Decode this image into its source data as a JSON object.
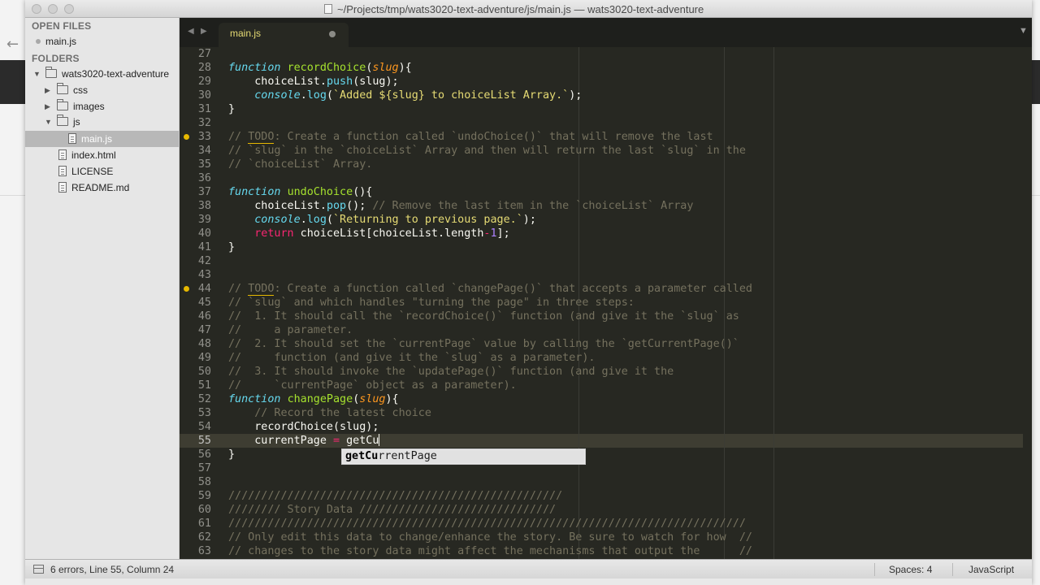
{
  "window": {
    "title": "~/Projects/tmp/wats3020-text-adventure/js/main.js — wats3020-text-adventure"
  },
  "sidebar": {
    "open_files_header": "OPEN FILES",
    "open_files": [
      {
        "label": "main.js"
      }
    ],
    "folders_header": "FOLDERS",
    "tree": [
      {
        "label": "wats3020-text-adventure",
        "type": "folder",
        "expanded": true,
        "depth": 0
      },
      {
        "label": "css",
        "type": "folder",
        "expanded": false,
        "depth": 1
      },
      {
        "label": "images",
        "type": "folder",
        "expanded": false,
        "depth": 1
      },
      {
        "label": "js",
        "type": "folder",
        "expanded": true,
        "depth": 1
      },
      {
        "label": "main.js",
        "type": "file",
        "selected": true,
        "depth": 2
      },
      {
        "label": "index.html",
        "type": "file",
        "depth": 1
      },
      {
        "label": "LICENSE",
        "type": "file",
        "depth": 1
      },
      {
        "label": "README.md",
        "type": "file",
        "depth": 1
      }
    ]
  },
  "tabs": [
    {
      "label": "main.js",
      "modified": true,
      "active": true
    }
  ],
  "editor": {
    "current_line": 55,
    "bookmarked_lines": [
      33,
      44
    ],
    "line_numbers": [
      "27",
      "28",
      "29",
      "30",
      "31",
      "32",
      "33",
      "34",
      "35",
      "36",
      "37",
      "38",
      "39",
      "40",
      "41",
      "42",
      "43",
      "44",
      "45",
      "46",
      "47",
      "48",
      "49",
      "50",
      "51",
      "52",
      "53",
      "54",
      "55",
      "56",
      "57",
      "58",
      "59",
      "60",
      "61",
      "62",
      "63"
    ],
    "code": [
      {
        "l": 27,
        "t": []
      },
      {
        "l": 28,
        "t": [
          [
            "kw",
            "function"
          ],
          [
            "",
            " "
          ],
          [
            "fn",
            "recordChoice"
          ],
          [
            "",
            "("
          ],
          [
            "param",
            "slug"
          ],
          [
            "",
            "){"
          ]
        ]
      },
      {
        "l": 29,
        "t": [
          [
            "",
            "    choiceList."
          ],
          [
            "meth",
            "push"
          ],
          [
            "",
            "(slug);"
          ]
        ]
      },
      {
        "l": 30,
        "t": [
          [
            "",
            "    "
          ],
          [
            "obj",
            "console"
          ],
          [
            "",
            "."
          ],
          [
            "meth",
            "log"
          ],
          [
            "",
            "("
          ],
          [
            "str",
            "`Added ${slug} to choiceList Array.`"
          ],
          [
            "",
            ");"
          ]
        ]
      },
      {
        "l": 31,
        "t": [
          [
            "",
            "}"
          ]
        ]
      },
      {
        "l": 32,
        "t": []
      },
      {
        "l": 33,
        "t": [
          [
            "cmt",
            "// "
          ],
          [
            "cmt todo-u",
            "TODO"
          ],
          [
            "cmt",
            ": Create a function called `undoChoice()` that will remove the last"
          ]
        ]
      },
      {
        "l": 34,
        "t": [
          [
            "cmt",
            "// `slug` in the `choiceList` Array and then will return the last `slug` in the"
          ]
        ]
      },
      {
        "l": 35,
        "t": [
          [
            "cmt",
            "// `choiceList` Array."
          ]
        ]
      },
      {
        "l": 36,
        "t": []
      },
      {
        "l": 37,
        "t": [
          [
            "kw",
            "function"
          ],
          [
            "",
            " "
          ],
          [
            "fn",
            "undoChoice"
          ],
          [
            "",
            "(){"
          ]
        ]
      },
      {
        "l": 38,
        "t": [
          [
            "",
            "    choiceList."
          ],
          [
            "meth",
            "pop"
          ],
          [
            "",
            "(); "
          ],
          [
            "cmt",
            "// Remove the last item in the `choiceList` Array"
          ]
        ]
      },
      {
        "l": 39,
        "t": [
          [
            "",
            "    "
          ],
          [
            "obj",
            "console"
          ],
          [
            "",
            "."
          ],
          [
            "meth",
            "log"
          ],
          [
            "",
            "("
          ],
          [
            "str",
            "`Returning to previous page.`"
          ],
          [
            "",
            ");"
          ]
        ]
      },
      {
        "l": 40,
        "t": [
          [
            "",
            "    "
          ],
          [
            "ret",
            "return"
          ],
          [
            "",
            " choiceList[choiceList.length"
          ],
          [
            "ret",
            "-"
          ],
          [
            "num",
            "1"
          ],
          [
            "",
            "];"
          ]
        ]
      },
      {
        "l": 41,
        "t": [
          [
            "",
            "}"
          ]
        ]
      },
      {
        "l": 42,
        "t": []
      },
      {
        "l": 43,
        "t": []
      },
      {
        "l": 44,
        "t": [
          [
            "cmt",
            "// "
          ],
          [
            "cmt todo-u",
            "TODO"
          ],
          [
            "cmt",
            ": Create a function called `changePage()` that accepts a parameter called"
          ]
        ]
      },
      {
        "l": 45,
        "t": [
          [
            "cmt",
            "// `slug` and which handles \"turning the page\" in three steps:"
          ]
        ]
      },
      {
        "l": 46,
        "t": [
          [
            "cmt",
            "//  1. It should call the `recordChoice()` function (and give it the `slug` as"
          ]
        ]
      },
      {
        "l": 47,
        "t": [
          [
            "cmt",
            "//     a parameter."
          ]
        ]
      },
      {
        "l": 48,
        "t": [
          [
            "cmt",
            "//  2. It should set the `currentPage` value by calling the `getCurrentPage()`"
          ]
        ]
      },
      {
        "l": 49,
        "t": [
          [
            "cmt",
            "//     function (and give it the `slug` as a parameter)."
          ]
        ]
      },
      {
        "l": 50,
        "t": [
          [
            "cmt",
            "//  3. It should invoke the `updatePage()` function (and give it the"
          ]
        ]
      },
      {
        "l": 51,
        "t": [
          [
            "cmt",
            "//     `currentPage` object as a parameter)."
          ]
        ]
      },
      {
        "l": 52,
        "t": [
          [
            "kw",
            "function"
          ],
          [
            "",
            " "
          ],
          [
            "fn",
            "changePage"
          ],
          [
            "",
            "("
          ],
          [
            "param",
            "slug"
          ],
          [
            "",
            "){"
          ]
        ]
      },
      {
        "l": 53,
        "t": [
          [
            "",
            "    "
          ],
          [
            "cmt",
            "// Record the latest choice"
          ]
        ]
      },
      {
        "l": 54,
        "t": [
          [
            "",
            "    recordChoice(slug);"
          ]
        ]
      },
      {
        "l": 55,
        "t": [
          [
            "",
            "    currentPage "
          ],
          [
            "ret",
            "="
          ],
          [
            "",
            " getCu"
          ]
        ],
        "caret": true
      },
      {
        "l": 56,
        "t": [
          [
            "",
            "}"
          ]
        ]
      },
      {
        "l": 57,
        "t": []
      },
      {
        "l": 58,
        "t": []
      },
      {
        "l": 59,
        "t": [
          [
            "cmt",
            "///////////////////////////////////////////////////"
          ]
        ]
      },
      {
        "l": 60,
        "t": [
          [
            "cmt",
            "//////// Story Data //////////////////////////////"
          ]
        ]
      },
      {
        "l": 61,
        "t": [
          [
            "cmt",
            "///////////////////////////////////////////////////////////////////////////////"
          ]
        ]
      },
      {
        "l": 62,
        "t": [
          [
            "cmt",
            "// Only edit this data to change/enhance the story. Be sure to watch for how  //"
          ]
        ]
      },
      {
        "l": 63,
        "t": [
          [
            "cmt",
            "// changes to the story data might affect the mechanisms that output the      //"
          ]
        ]
      }
    ]
  },
  "autocomplete": {
    "match": "getCu",
    "rest": "rrentPage"
  },
  "statusbar": {
    "status": "6 errors, Line 55, Column 24",
    "spaces": "Spaces: 4",
    "syntax": "JavaScript"
  }
}
